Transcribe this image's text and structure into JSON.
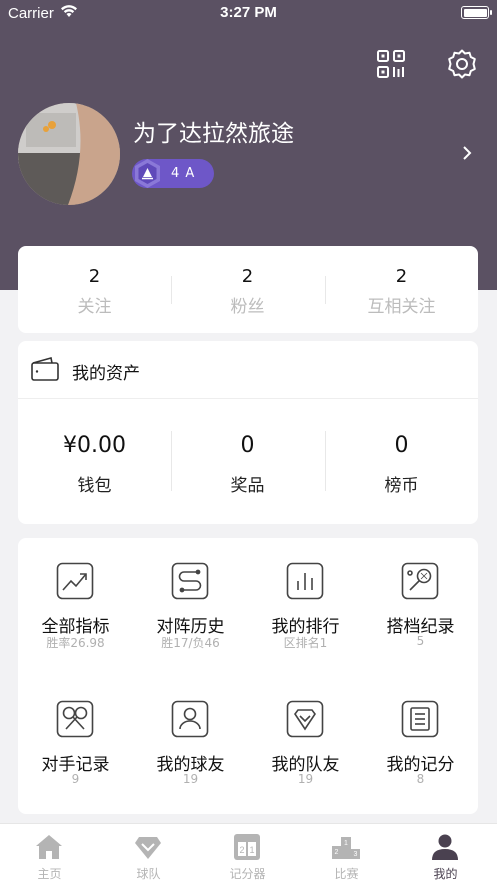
{
  "status_bar": {
    "carrier": "Carrier",
    "time": "3:27 PM"
  },
  "header": {
    "icons": [
      "qr-code-icon",
      "gear-icon"
    ],
    "username": "为了达拉然旅途",
    "level": "4 A"
  },
  "follow_stats": [
    {
      "count": "2",
      "label": "关注"
    },
    {
      "count": "2",
      "label": "粉丝"
    },
    {
      "count": "2",
      "label": "互相关注"
    }
  ],
  "assets": {
    "title": "我的资产",
    "items": [
      {
        "value": "¥0.00",
        "label": "钱包"
      },
      {
        "value": "0",
        "label": "奖品"
      },
      {
        "value": "0",
        "label": "榜币"
      }
    ]
  },
  "features": [
    {
      "title": "全部指标",
      "sub": "胜率26.98",
      "icon": "trend-chart-icon"
    },
    {
      "title": "对阵历史",
      "sub": "胜17/负46",
      "icon": "route-icon"
    },
    {
      "title": "我的排行",
      "sub": "区排名1",
      "icon": "bar-chart-icon"
    },
    {
      "title": "搭档纪录",
      "sub": "5",
      "icon": "badminton-racket-icon"
    },
    {
      "title": "对手记录",
      "sub": "9",
      "icon": "crossed-rackets-icon"
    },
    {
      "title": "我的球友",
      "sub": "19",
      "icon": "person-icon"
    },
    {
      "title": "我的队友",
      "sub": "19",
      "icon": "team-badge-icon"
    },
    {
      "title": "我的记分",
      "sub": "8",
      "icon": "scorecard-icon"
    }
  ],
  "tabs": [
    {
      "label": "主页",
      "icon": "home-icon",
      "active": false
    },
    {
      "label": "球队",
      "icon": "team-icon",
      "active": false
    },
    {
      "label": "记分器",
      "icon": "scoreboard-icon",
      "active": false
    },
    {
      "label": "比赛",
      "icon": "podium-icon",
      "active": false
    },
    {
      "label": "我的",
      "icon": "profile-icon",
      "active": true
    }
  ],
  "colors": {
    "header_bg": "#5b5163",
    "badge": "#6e57c8",
    "accent_dark": "#4a4150"
  }
}
